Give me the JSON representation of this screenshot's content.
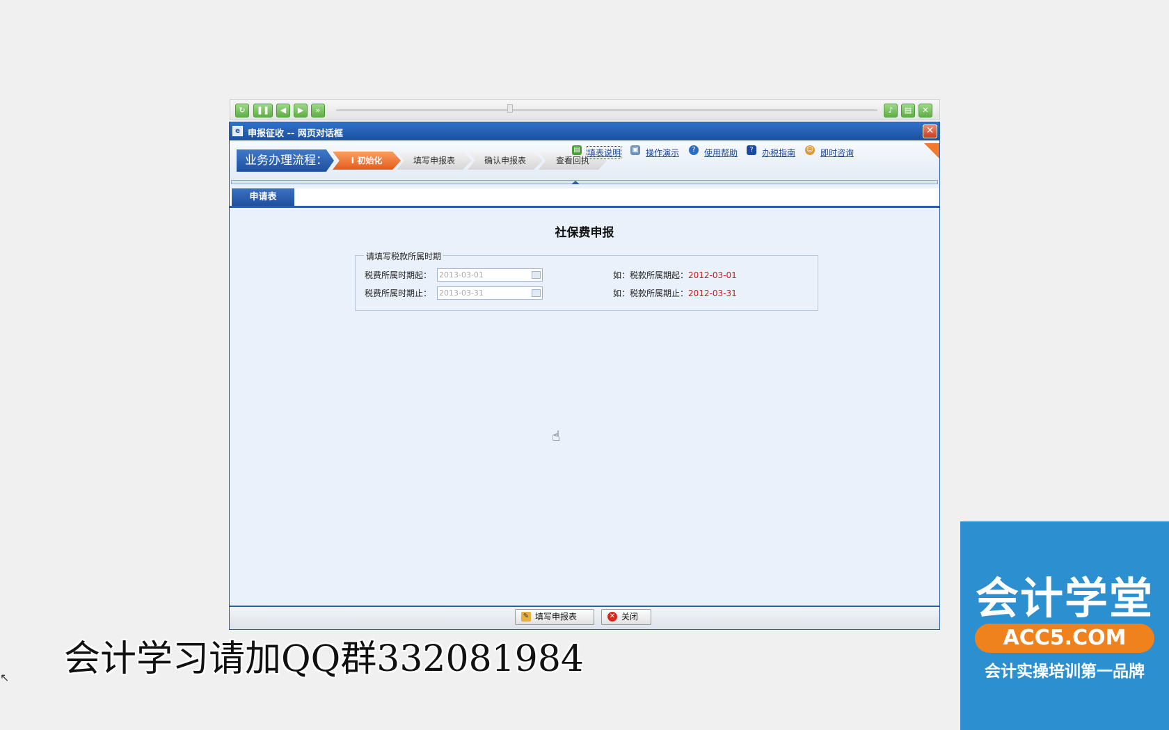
{
  "player": {
    "buttons": [
      "reload-icon",
      "pause-icon",
      "prev-icon",
      "next-icon",
      "fast-forward-icon"
    ],
    "right_buttons": [
      "volume-icon",
      "save-icon",
      "close-icon"
    ]
  },
  "dialog": {
    "title": "申报征收 -- 网页对话框",
    "close_glyph": "✕"
  },
  "flow": {
    "label": "业务办理流程：",
    "steps": [
      {
        "label": "Ⅰ 初始化",
        "active": true
      },
      {
        "label": "填写申报表",
        "active": false
      },
      {
        "label": "确认申报表",
        "active": false
      },
      {
        "label": "查看回执",
        "active": false
      }
    ],
    "links": [
      {
        "label": "填表说明",
        "icon": "form-guide-icon"
      },
      {
        "label": "操作演示",
        "icon": "demo-icon"
      },
      {
        "label": "使用帮助",
        "icon": "help-icon"
      },
      {
        "label": "办税指南",
        "icon": "guide-book-icon"
      },
      {
        "label": "即时咨询",
        "icon": "chat-icon"
      }
    ]
  },
  "tab": {
    "label": "申请表"
  },
  "form": {
    "title": "社保费申报",
    "legend": "请填写税款所属时期",
    "start": {
      "label": "税费所属时期起：",
      "value": "2013-03-01",
      "hint_prefix": "如：税款所属期起：",
      "hint_value": "2012-03-01"
    },
    "end": {
      "label": "税费所属时期止：",
      "value": "2013-03-31",
      "hint_prefix": "如：税款所属期止：",
      "hint_value": "2012-03-31"
    }
  },
  "buttons": {
    "fill": "填写申报表",
    "close": "关闭"
  },
  "overlay": {
    "caption": "会计学习请加QQ群332081984",
    "brand_name": "会计学堂",
    "brand_url": "ACC5.COM",
    "brand_slogan": "会计实操培训第一品牌"
  },
  "colors": {
    "accent": "#2a5fa8",
    "active_step": "#e55b1a",
    "hint_red": "#cc1a1a",
    "brand_blue": "#2b8fd0",
    "brand_orange": "#f0821e"
  }
}
